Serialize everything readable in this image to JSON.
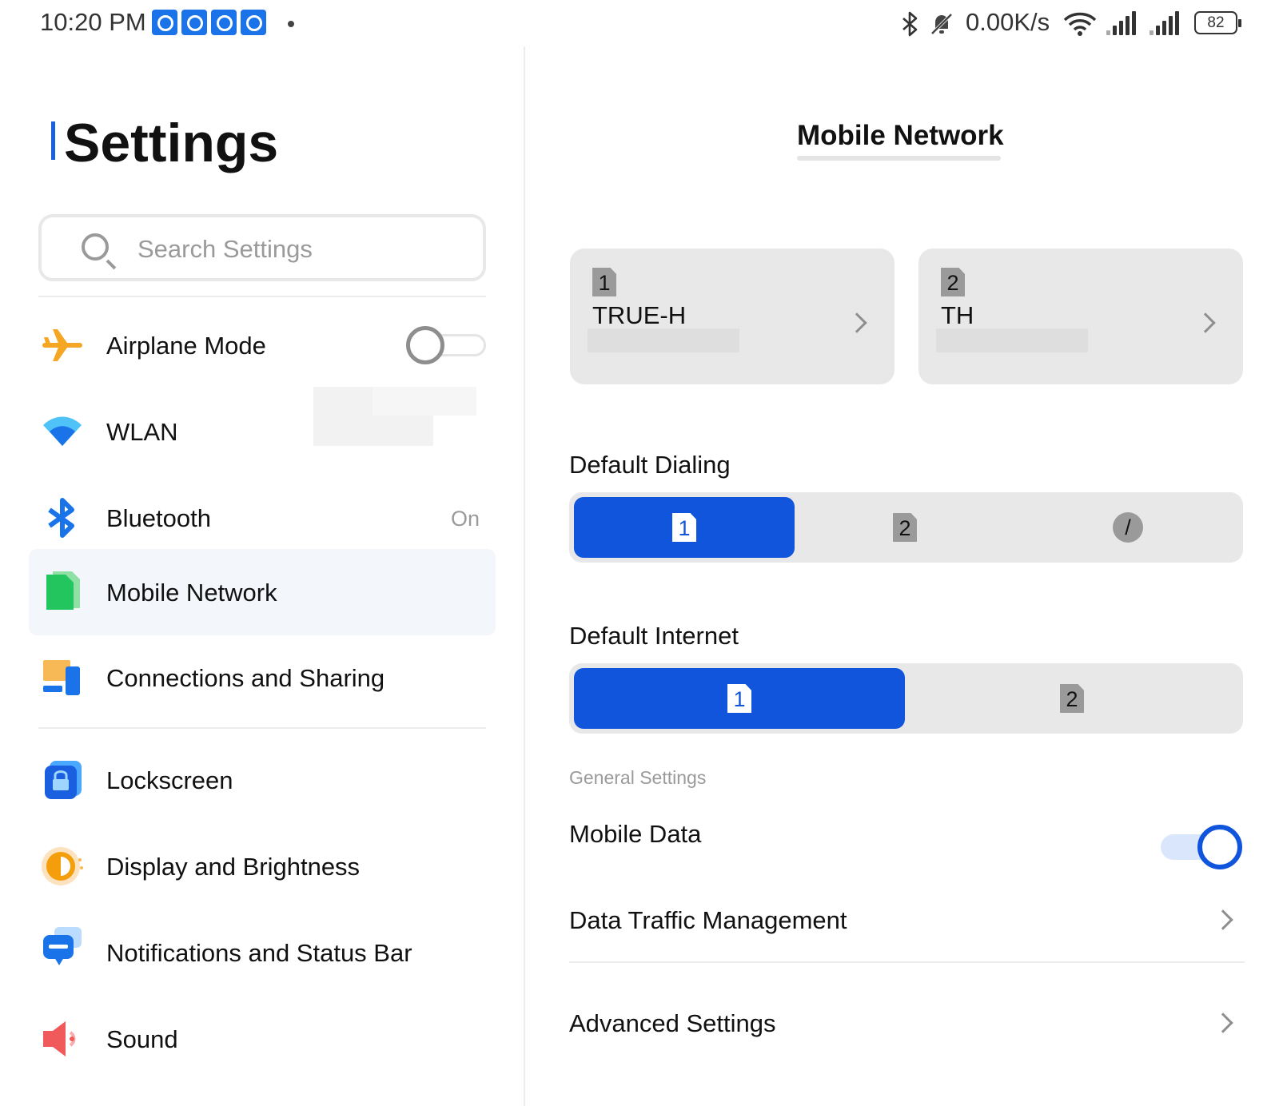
{
  "status_bar": {
    "time": "10:20 PM",
    "net_speed": "0.00K/s",
    "battery": "82",
    "icons": [
      "notification-badge-icon",
      "bluetooth-icon",
      "mute-icon",
      "wifi-icon",
      "signal-sim1-icon",
      "signal-sim2-icon",
      "battery-icon"
    ]
  },
  "sidebar": {
    "title": "Settings",
    "search_placeholder": "Search Settings",
    "items": [
      {
        "label": "Airplane Mode",
        "icon": "airplane-icon",
        "toggle": false
      },
      {
        "label": "WLAN",
        "icon": "wifi-icon"
      },
      {
        "label": "Bluetooth",
        "icon": "bluetooth-icon",
        "value": "On"
      },
      {
        "label": "Mobile Network",
        "icon": "sim-card-icon",
        "selected": true
      },
      {
        "label": "Connections and Sharing",
        "icon": "connections-icon"
      },
      {
        "label": "Lockscreen",
        "icon": "lock-icon"
      },
      {
        "label": "Display and Brightness",
        "icon": "brightness-icon"
      },
      {
        "label": "Notifications and Status Bar",
        "icon": "notification-icon"
      },
      {
        "label": "Sound",
        "icon": "speaker-icon"
      }
    ]
  },
  "main": {
    "title": "Mobile Network",
    "sims": [
      {
        "slot": "1",
        "name": "TRUE-H"
      },
      {
        "slot": "2",
        "name": "TH"
      }
    ],
    "default_dialing": {
      "label": "Default Dialing",
      "options": [
        "1",
        "2",
        "/"
      ],
      "selected": "1"
    },
    "default_internet": {
      "label": "Default Internet",
      "options": [
        "1",
        "2"
      ],
      "selected": "1"
    },
    "general_settings_label": "General Settings",
    "mobile_data": {
      "label": "Mobile Data",
      "enabled": true
    },
    "data_traffic": {
      "label": "Data Traffic Management"
    },
    "advanced": {
      "label": "Advanced Settings"
    }
  },
  "colors": {
    "accent": "#1155dd",
    "selected_row_bg": "#f3f6fb",
    "card_bg": "#e8e8e8"
  }
}
